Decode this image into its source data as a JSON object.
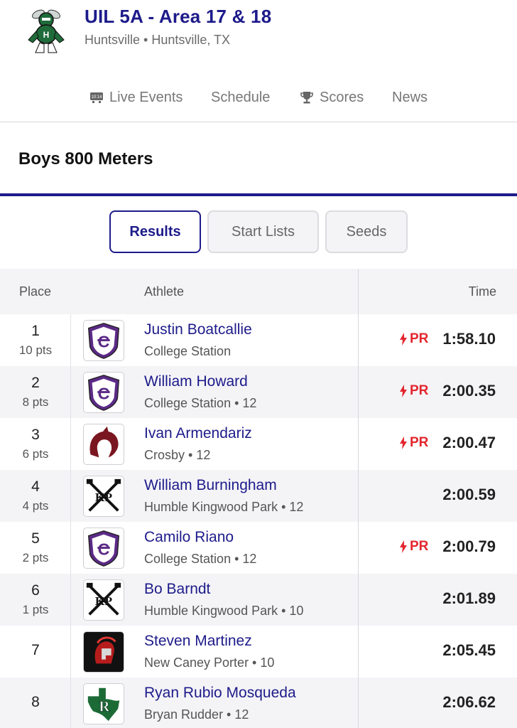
{
  "header": {
    "title": "UIL 5A - Area 17 & 18",
    "subtitle": "Huntsville • Huntsville, TX",
    "logo_icon": "hornet-mascot-logo"
  },
  "nav": [
    {
      "label": "Live Events",
      "icon": "live-clock-icon",
      "icon_text": "10:14"
    },
    {
      "label": "Schedule"
    },
    {
      "label": "Scores",
      "icon": "trophy-icon"
    },
    {
      "label": "News"
    }
  ],
  "event": {
    "title": "Boys 800 Meters"
  },
  "tabs": [
    {
      "label": "Results",
      "active": true
    },
    {
      "label": "Start Lists",
      "active": false
    },
    {
      "label": "Seeds",
      "active": false
    }
  ],
  "table": {
    "headers": {
      "place": "Place",
      "athlete": "Athlete",
      "time": "Time"
    },
    "pr_label": "PR",
    "rows": [
      {
        "place": "1",
        "pts": "10 pts",
        "name": "Justin Boatcallie",
        "team": "College Station",
        "pr": true,
        "time": "1:58.10",
        "logo": "college-station-shield"
      },
      {
        "place": "2",
        "pts": "8 pts",
        "name": "William Howard",
        "team": "College Station • 12",
        "pr": true,
        "time": "2:00.35",
        "logo": "college-station-shield"
      },
      {
        "place": "3",
        "pts": "6 pts",
        "name": "Ivan Armendariz",
        "team": "Crosby • 12",
        "pr": true,
        "time": "2:00.47",
        "logo": "crosby-cougar"
      },
      {
        "place": "4",
        "pts": "4 pts",
        "name": "William Burningham",
        "team": "Humble Kingwood Park • 12",
        "pr": false,
        "time": "2:00.59",
        "logo": "kingwood-park-kp"
      },
      {
        "place": "5",
        "pts": "2 pts",
        "name": "Camilo Riano",
        "team": "College Station • 12",
        "pr": true,
        "time": "2:00.79",
        "logo": "college-station-shield"
      },
      {
        "place": "6",
        "pts": "1 pts",
        "name": "Bo Barndt",
        "team": "Humble Kingwood Park • 10",
        "pr": false,
        "time": "2:01.89",
        "logo": "kingwood-park-kp"
      },
      {
        "place": "7",
        "pts": "",
        "name": "Steven Martinez",
        "team": "New Caney Porter • 10",
        "pr": false,
        "time": "2:05.45",
        "logo": "porter-spartan"
      },
      {
        "place": "8",
        "pts": "",
        "name": "Ryan Rubio Mosqueda",
        "team": "Bryan Rudder • 12",
        "pr": false,
        "time": "2:06.62",
        "logo": "rudder-texas-r"
      }
    ]
  },
  "colors": {
    "accent": "#1d1b8a",
    "pr": "#e3262e",
    "row_alt": "#f4f4f7"
  }
}
